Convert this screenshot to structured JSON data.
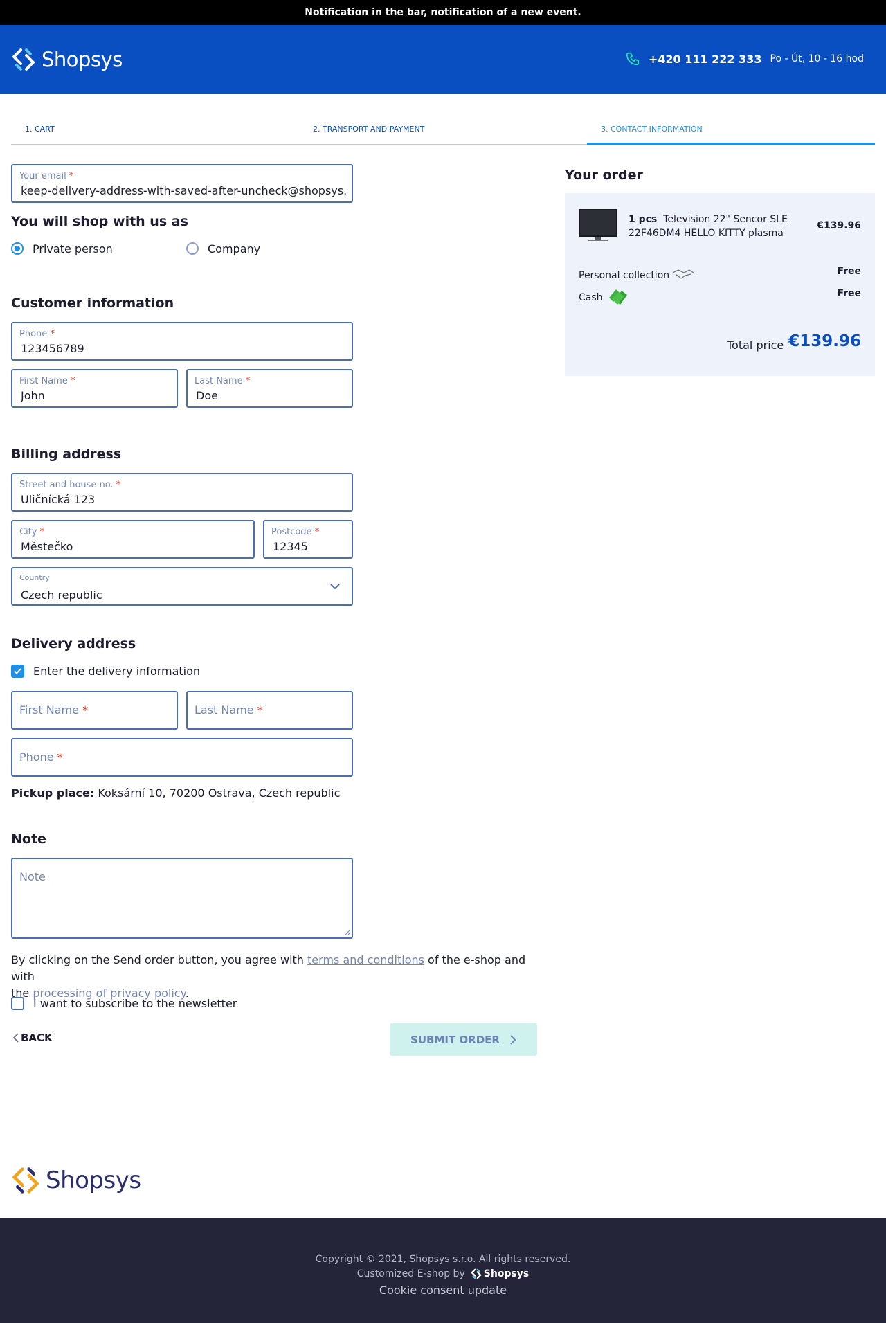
{
  "notification": "Notification in the bar, notification of a new event.",
  "header": {
    "logo_text": "Shopsys",
    "phone": "+420 111 222 333",
    "hours": "Po - Út, 10 - 16 hod",
    "brand_color": "#0a4fc2"
  },
  "steps": [
    {
      "label": "1. CART"
    },
    {
      "label": "2. TRANSPORT AND PAYMENT"
    },
    {
      "label": "3. CONTACT INFORMATION",
      "active": true
    }
  ],
  "email": {
    "label": "Your email",
    "required": "*",
    "value": "keep-delivery-address-with-saved-after-uncheck@shopsys.com"
  },
  "shop_as": {
    "title": "You will shop with us as",
    "options": [
      {
        "label": "Private person",
        "selected": true
      },
      {
        "label": "Company",
        "selected": false
      }
    ]
  },
  "customer": {
    "title": "Customer information",
    "phone": {
      "label": "Phone",
      "value": "123456789"
    },
    "first_name": {
      "label": "First Name",
      "value": "John"
    },
    "last_name": {
      "label": "Last Name",
      "value": "Doe"
    }
  },
  "billing": {
    "title": "Billing address",
    "street": {
      "label": "Street and house no.",
      "value": "Uličnícká 123"
    },
    "city": {
      "label": "City",
      "value": "Městečko"
    },
    "postcode": {
      "label": "Postcode",
      "value": "12345"
    },
    "country": {
      "label": "Country",
      "value": "Czech republic"
    }
  },
  "delivery": {
    "title": "Delivery address",
    "checkbox_label": "Enter the delivery information",
    "checked": true,
    "first_name_placeholder": "First Name",
    "last_name_placeholder": "Last Name",
    "phone_placeholder": "Phone",
    "pickup_label": "Pickup place:",
    "pickup_value": "Koksární 10, 70200 Ostrava, Czech republic"
  },
  "note": {
    "title": "Note",
    "placeholder": "Note"
  },
  "agreement": {
    "part1": "By clicking on the Send order button, you agree with ",
    "link1": "terms and conditions",
    "part2": " of the e-shop and with",
    "part3": "the ",
    "link2": "processing of privacy policy",
    "part4": "."
  },
  "newsletter": {
    "label": "I want to subscribe to the newsletter",
    "checked": false
  },
  "actions": {
    "back": "BACK",
    "submit": "SUBMIT ORDER"
  },
  "order": {
    "title": "Your order",
    "item": {
      "qty": "1 pcs",
      "name_line1": "Television 22\" Sencor SLE",
      "name_line2": "22F46DM4 HELLO KITTY plasma",
      "price": "€139.96"
    },
    "transport": {
      "label": "Personal collection",
      "price": "Free"
    },
    "payment": {
      "label": "Cash",
      "price": "Free"
    },
    "total_label": "Total price",
    "total_value": "€139.96"
  },
  "footer": {
    "logo_text": "Shopsys",
    "copyright": "Copyright © 2021, Shopsys s.r.o. All rights reserved.",
    "customized": "Customized E-shop by",
    "customized_brand": "Shopsys",
    "cookie": "Cookie consent update"
  }
}
